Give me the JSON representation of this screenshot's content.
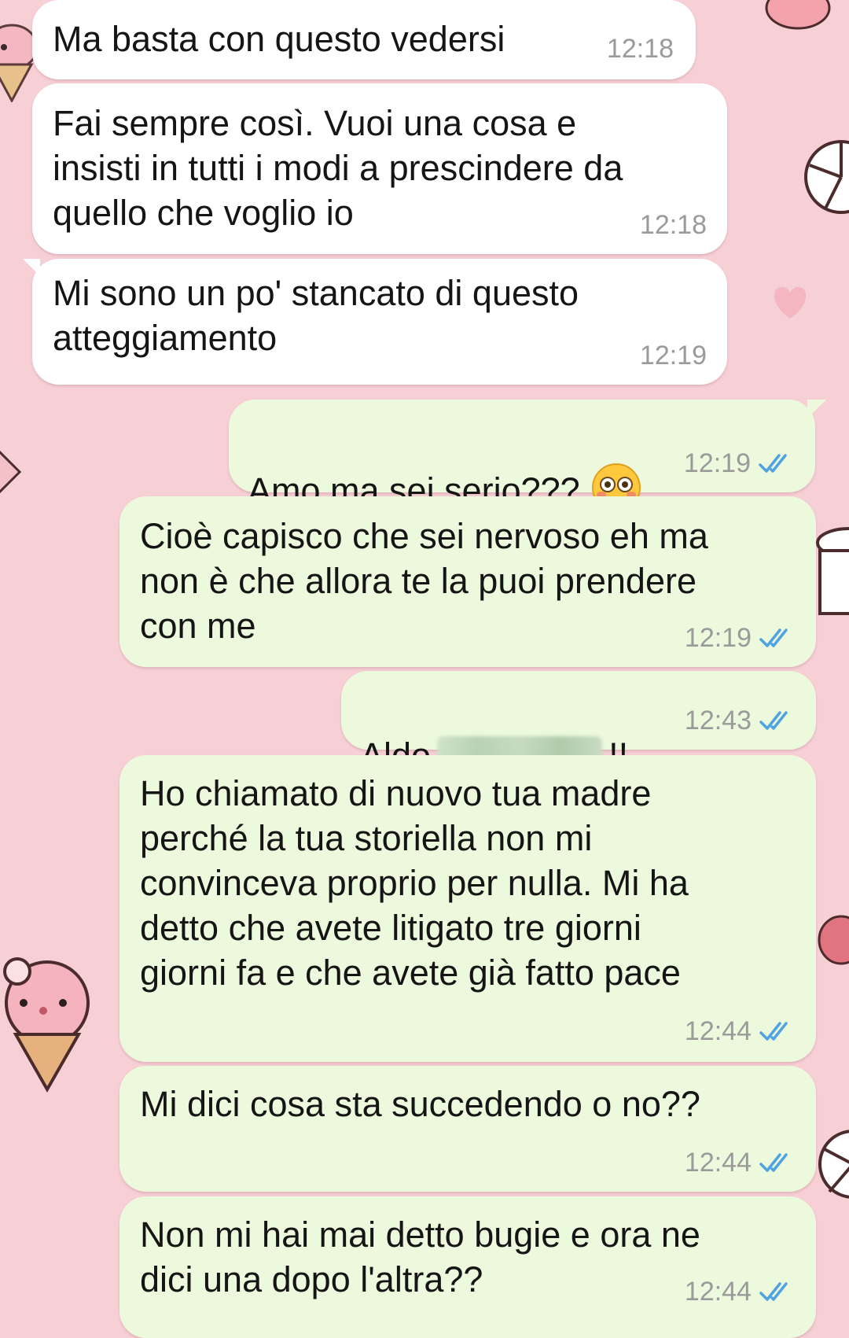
{
  "wallpaper": {
    "background_color": "#f7d0d6",
    "decorations": [
      "cupcake-icon",
      "ice-cream-icon",
      "candy-icon",
      "heart-icon",
      "cake-slice-icon",
      "coffee-cup-icon"
    ]
  },
  "messages": [
    {
      "direction": "in",
      "text": "Ma basta con questo vedersi",
      "time": "12:18"
    },
    {
      "direction": "in",
      "text": "Fai sempre così. Vuoi una cosa e\ninsisti in tutti i modi a prescindere da\nquello che voglio io",
      "time": "12:18"
    },
    {
      "direction": "in",
      "text": "Mi sono un po' stancato di questo\natteggiamento",
      "time": "12:19"
    },
    {
      "direction": "out",
      "text": "Amo ma sei serio???",
      "emoji": "flushed-face-emoji",
      "time": "12:19",
      "status": "read"
    },
    {
      "direction": "out",
      "text": "Cioè capisco che sei nervoso eh ma\nnon è che allora te la puoi prendere\ncon me",
      "time": "12:19",
      "status": "read"
    },
    {
      "direction": "out",
      "text_before": "Aldo",
      "text_after": "!!",
      "redacted": true,
      "time": "12:43",
      "status": "read"
    },
    {
      "direction": "out",
      "text": "Ho chiamato di nuovo tua madre\nperché la tua storiella non mi\nconvinceva proprio per nulla. Mi ha\ndetto che avete litigato tre giorni\ngiorni fa e che avete già fatto pace",
      "time": "12:44",
      "status": "read"
    },
    {
      "direction": "out",
      "text": "Mi dici cosa sta succedendo o no??",
      "time": "12:44",
      "status": "read"
    },
    {
      "direction": "out",
      "text": "Non mi hai mai detto bugie e ora ne\ndici una dopo l'altra??",
      "time": "12:44",
      "status": "read"
    }
  ],
  "colors": {
    "incoming_bubble": "#ffffff",
    "outgoing_bubble": "#edf9dd",
    "timestamp": "#9a9a9a",
    "read_check": "#4fa3e0"
  }
}
